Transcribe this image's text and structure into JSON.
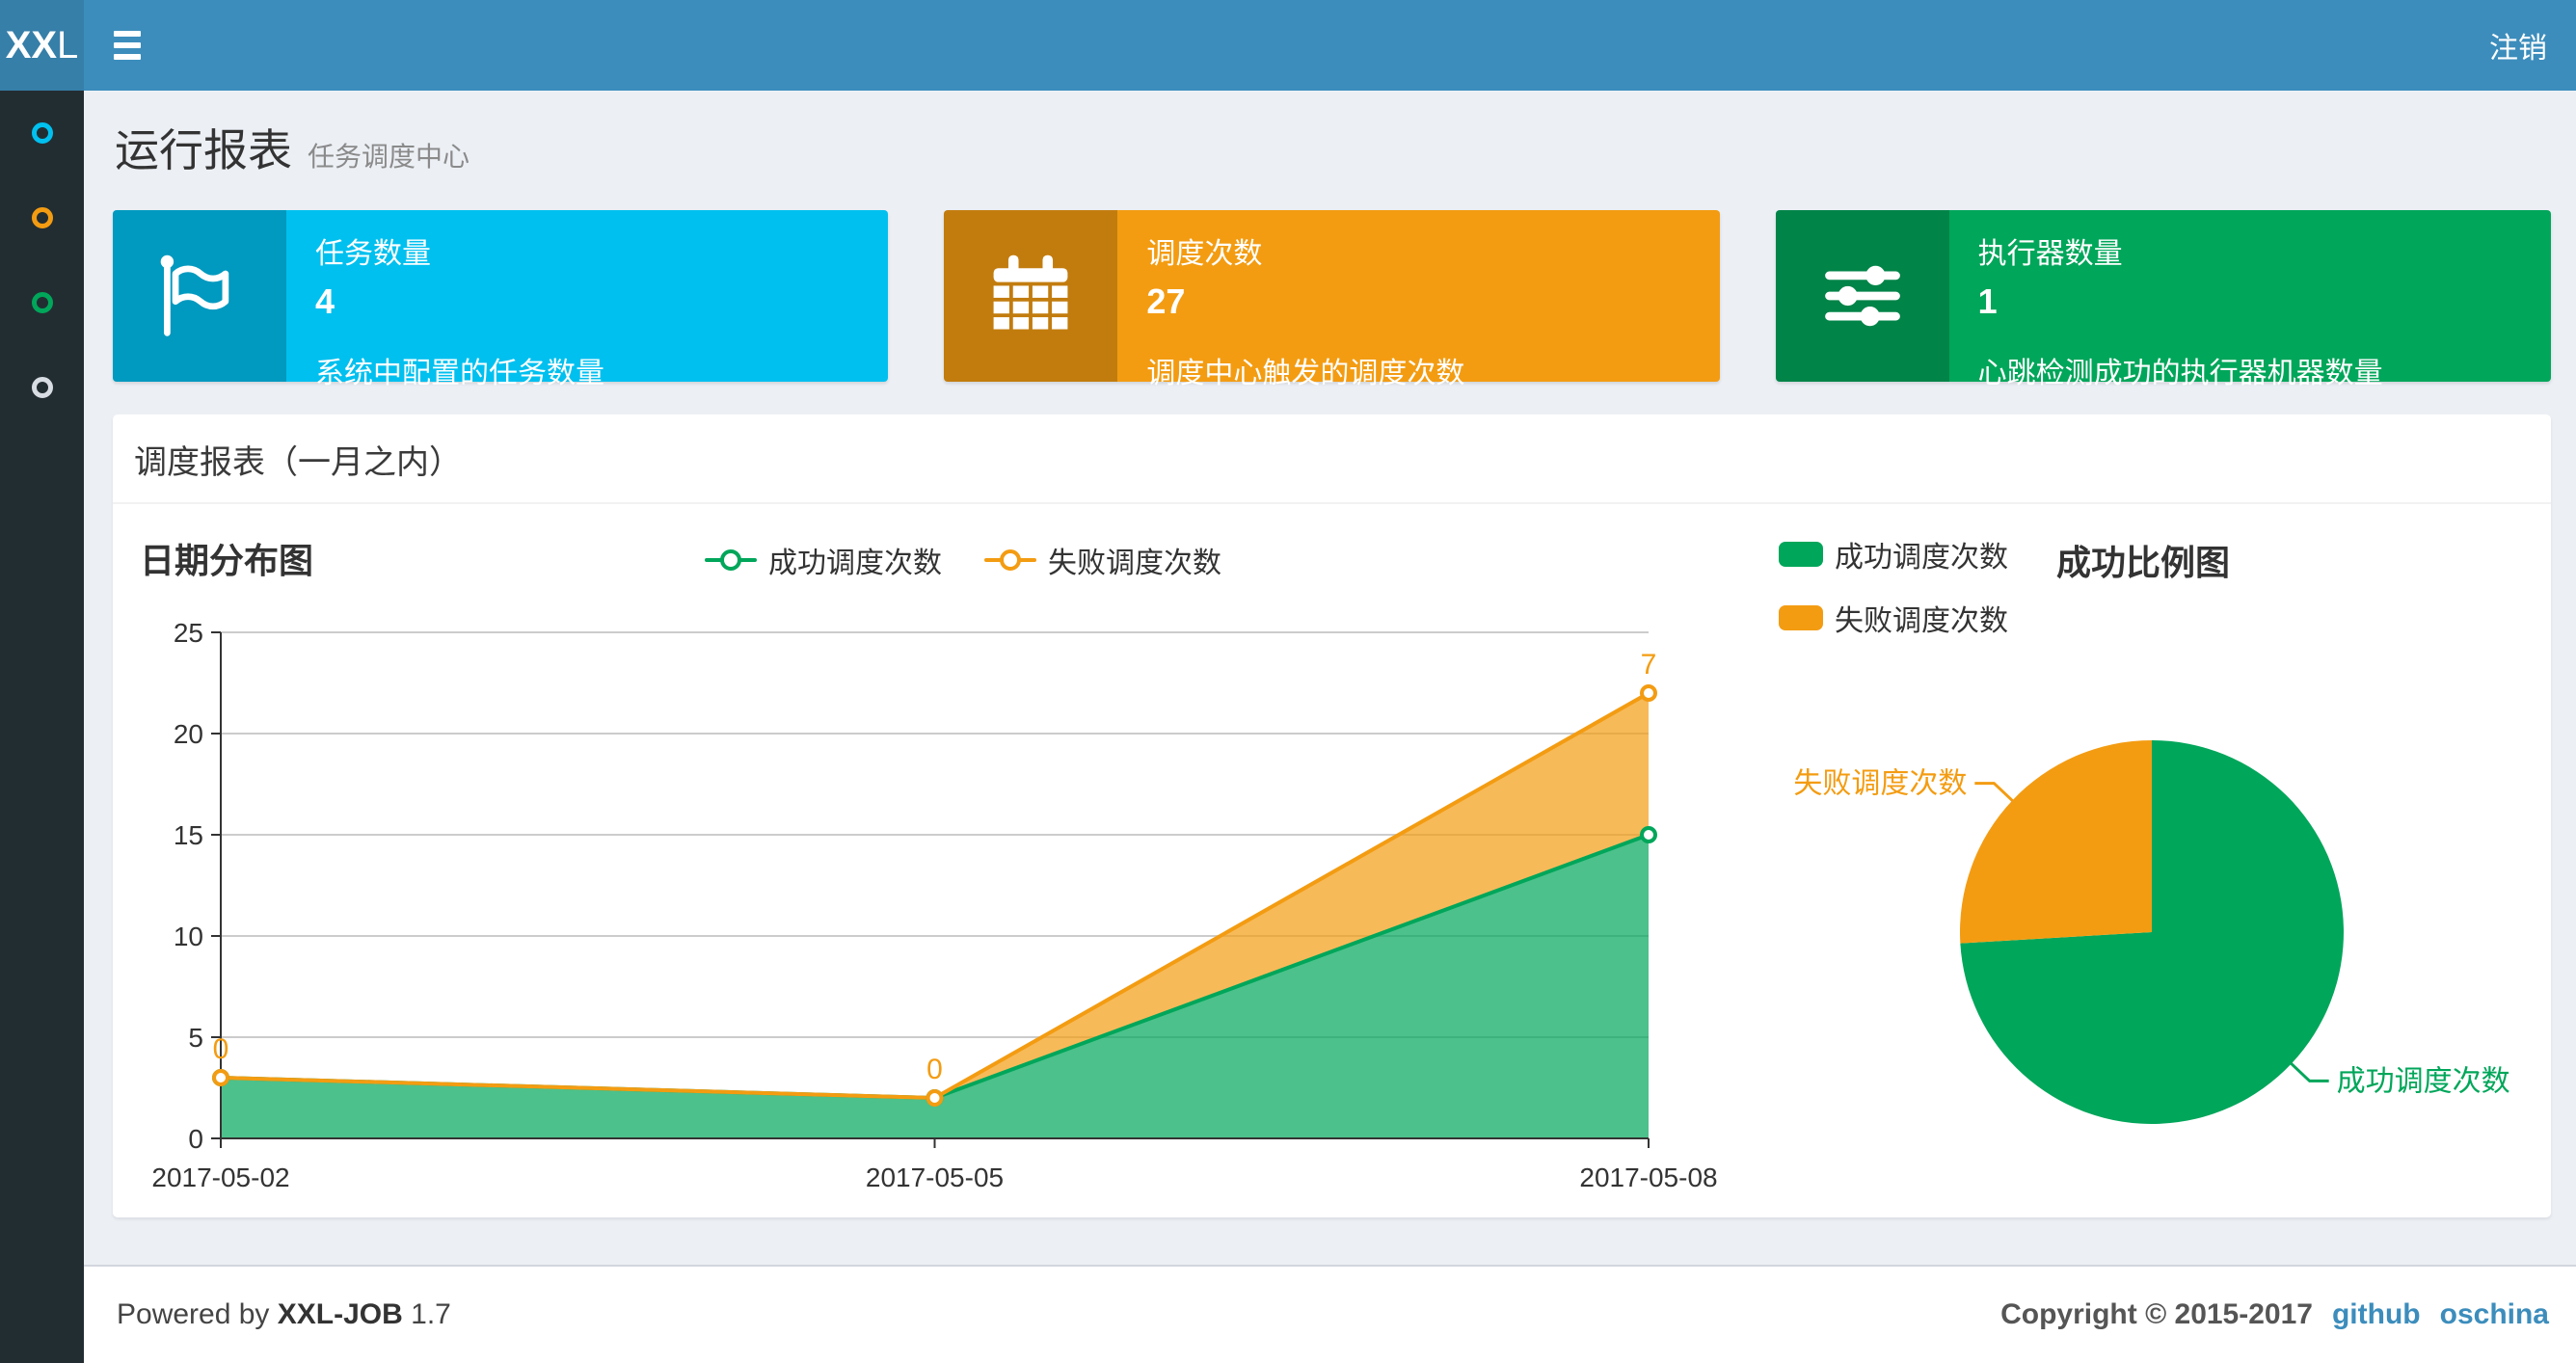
{
  "header": {
    "logo_bold": "XX",
    "logo_light": "L",
    "logout_label": "注销"
  },
  "sidebar": {
    "items": [
      {
        "icon": "circle-outline-icon",
        "color": "#00c0ef"
      },
      {
        "icon": "circle-outline-icon",
        "color": "#f39c12"
      },
      {
        "icon": "circle-outline-icon",
        "color": "#00a65a"
      },
      {
        "icon": "circle-outline-icon",
        "color": "#d8dde3"
      }
    ]
  },
  "page": {
    "title": "运行报表",
    "subtitle": "任务调度中心"
  },
  "cards": [
    {
      "icon": "flag-icon",
      "label": "任务数量",
      "value": "4",
      "description": "系统中配置的任务数量",
      "color": "#00c0ef"
    },
    {
      "icon": "calendar-icon",
      "label": "调度次数",
      "value": "27",
      "description": "调度中心触发的调度次数",
      "color": "#f39c12"
    },
    {
      "icon": "sliders-icon",
      "label": "执行器数量",
      "value": "1",
      "description": "心跳检测成功的执行器机器数量",
      "color": "#00a65a"
    }
  ],
  "panel": {
    "title": "调度报表（一月之内）"
  },
  "chart_data": [
    {
      "type": "area",
      "title": "日期分布图",
      "x": [
        "2017-05-02",
        "2017-05-05",
        "2017-05-08"
      ],
      "stacked": true,
      "series": [
        {
          "name": "成功调度次数",
          "color": "#00a65a",
          "values": [
            3,
            2,
            15
          ],
          "show_labels": false
        },
        {
          "name": "失败调度次数",
          "color": "#f39c12",
          "values": [
            0,
            0,
            7
          ],
          "show_labels": true
        }
      ],
      "ylim": [
        0,
        25
      ],
      "ytick_step": 5,
      "grid": true,
      "legend_position": "top"
    },
    {
      "type": "pie",
      "title": "成功比例图",
      "start_angle": 90,
      "clockwise": true,
      "legend_position": "top-left",
      "slices": [
        {
          "name": "成功调度次数",
          "value": 20,
          "color": "#00a65a"
        },
        {
          "name": "失败调度次数",
          "value": 7,
          "color": "#f39c12"
        }
      ]
    }
  ],
  "footer": {
    "powered_prefix": "Powered by",
    "product": "XXL-JOB",
    "version": "1.7",
    "copyright": "Copyright © 2015-2017",
    "links": [
      {
        "label": "github"
      },
      {
        "label": "oschina"
      }
    ]
  },
  "colors": {
    "navbar": "#3c8dbc",
    "logo_bg": "#367fa9",
    "sidebar_bg": "#222d32",
    "content_bg": "#ecf0f5",
    "success": "#00a65a",
    "fail": "#f39c12",
    "aqua": "#00c0ef",
    "link": "#3c8dbc"
  }
}
